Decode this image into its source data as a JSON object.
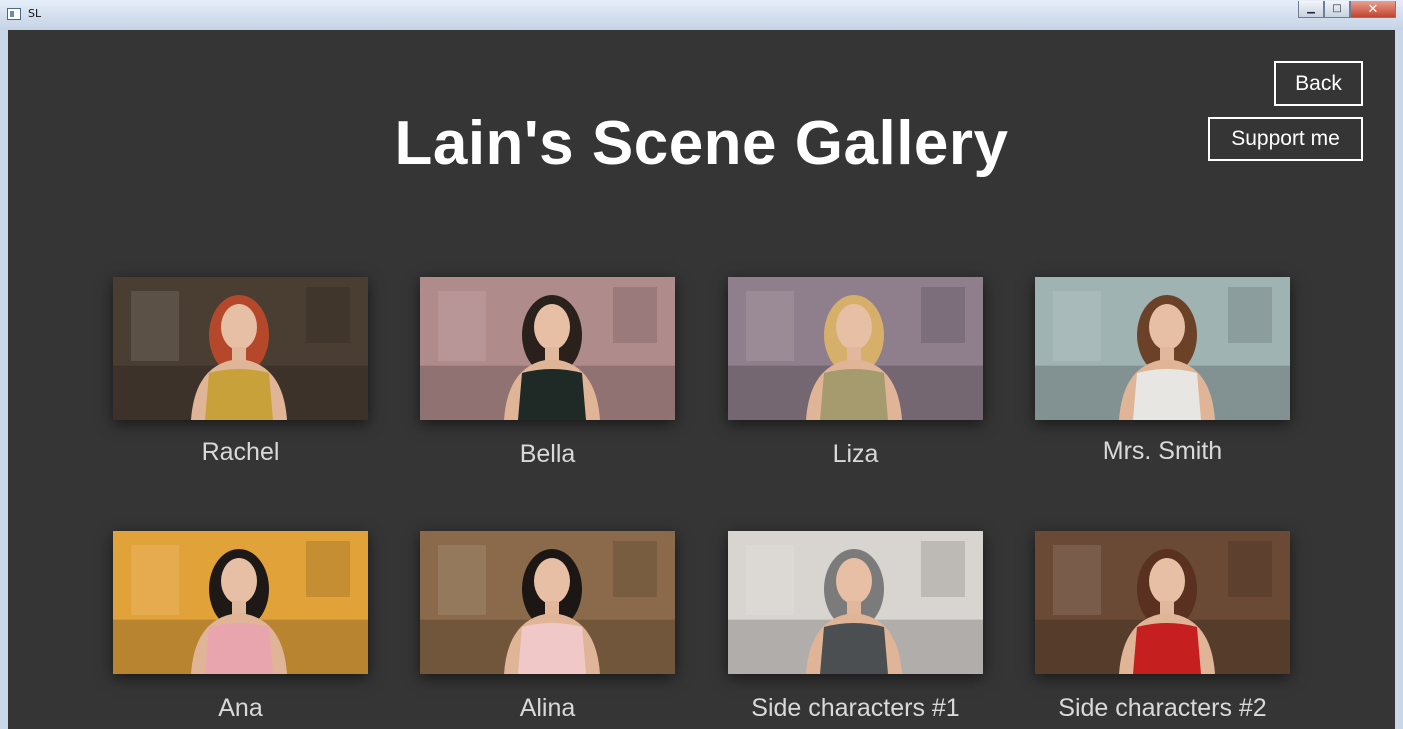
{
  "window": {
    "title": "SL",
    "controls": {
      "minimize": "▁",
      "maximize": "□",
      "close": "✕"
    }
  },
  "gallery": {
    "title": "Lain's Scene Gallery",
    "back_label": "Back",
    "support_label": "Support me"
  },
  "characters": [
    {
      "name": "Rachel",
      "hair": "#b5482a",
      "top": "#c9a13a",
      "bg": "#4a3e33"
    },
    {
      "name": "Bella",
      "hair": "#2a211c",
      "top": "#1f2a26",
      "bg": "#b08b8c"
    },
    {
      "name": "Liza",
      "hair": "#d6b06a",
      "top": "#a69b6e",
      "bg": "#8f7e8c"
    },
    {
      "name": "Mrs. Smith",
      "hair": "#6b4128",
      "top": "#e8e6e2",
      "bg": "#9fb3b3"
    },
    {
      "name": "Ana",
      "hair": "#1e1816",
      "top": "#e9a5ad",
      "bg": "#e2a23a"
    },
    {
      "name": "Alina",
      "hair": "#1c1614",
      "top": "#f0c8c8",
      "bg": "#8a6a4a"
    },
    {
      "name": "Side characters #1",
      "hair": "#7b7b7b",
      "top": "#4c4f52",
      "bg": "#d8d4d0"
    },
    {
      "name": "Side characters #2",
      "hair": "#5a3020",
      "top": "#c51f1f",
      "bg": "#6a4a35"
    }
  ]
}
